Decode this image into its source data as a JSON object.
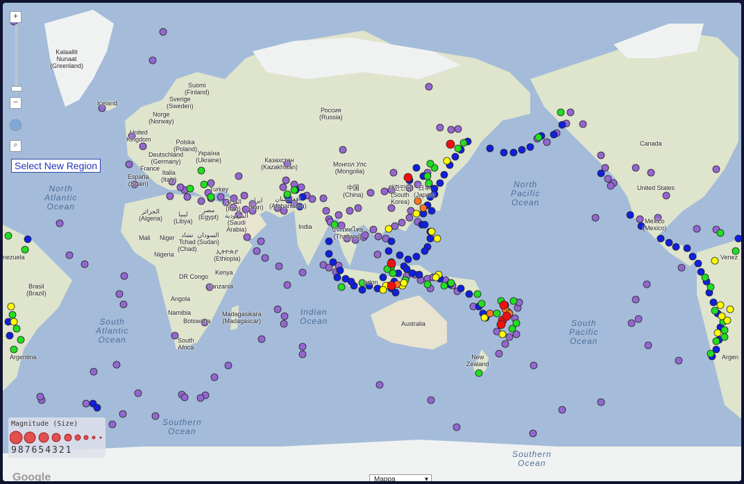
{
  "controls": {
    "zoom_in": "+",
    "zoom_out": "−",
    "select_region": "Select New Region",
    "map_type": "Mappa",
    "google": "Google"
  },
  "legend": {
    "title": "Magnitude (Size)",
    "numbers": "987654321"
  },
  "colors": {
    "ocean": "#a4bcd9",
    "land": "#dfe4cc",
    "magnitude_classes": {
      "purple": "#9467d0",
      "blue": "#1020dd",
      "green": "#22dd22",
      "yellow": "#ffff00",
      "orange": "#ff7722",
      "red": "#ee1111"
    }
  },
  "ocean_labels": [
    {
      "key": "north_atlantic",
      "text": "North\nAtlantic\nOcean"
    },
    {
      "key": "north_pacific",
      "text": "North\nPacific\nOcean"
    },
    {
      "key": "south_atlantic",
      "text": "South\nAtlantic\nOcean"
    },
    {
      "key": "indian",
      "text": "Indian\nOcean"
    },
    {
      "key": "south_pacific",
      "text": "South\nPacific\nOcean"
    },
    {
      "key": "southern1",
      "text": "Southern\nOcean"
    },
    {
      "key": "southern2",
      "text": "Southern\nOcean"
    }
  ],
  "place_labels": [
    {
      "key": "greenland",
      "text": "Kalaallit\nNunaat\n(Greenland)"
    },
    {
      "key": "iceland",
      "text": "Iceland"
    },
    {
      "key": "suomi",
      "text": "Suomi\n(Finland)"
    },
    {
      "key": "sverige",
      "text": "Sverige\n(Sweden)"
    },
    {
      "key": "norge",
      "text": "Norge\n(Norway)"
    },
    {
      "key": "uk",
      "text": "United\nKingdom"
    },
    {
      "key": "poland",
      "text": "Polska\n(Poland)"
    },
    {
      "key": "germany",
      "text": "Deutschland\n(Germany)"
    },
    {
      "key": "ukraine",
      "text": "Україна\n(Ukraine)"
    },
    {
      "key": "france",
      "text": "France"
    },
    {
      "key": "italy",
      "text": "Italia\n(Italy)"
    },
    {
      "key": "spain",
      "text": "España\n(Spain)"
    },
    {
      "key": "turkey",
      "text": "Turkey"
    },
    {
      "key": "russia",
      "text": "Россия\n(Russia)"
    },
    {
      "key": "kazakhstan",
      "text": "Казахстан\n(Kazakhstan)"
    },
    {
      "key": "mongolia",
      "text": "Монгол Улс\n(Mongolia)"
    },
    {
      "key": "china",
      "text": "中国\n(China)"
    },
    {
      "key": "skorea",
      "text": "대한민국\n(South\nKorea)"
    },
    {
      "key": "japan",
      "text": "日本\n(Japan)"
    },
    {
      "key": "algeria",
      "text": "الجزائر\n(Algeria)"
    },
    {
      "key": "libya",
      "text": "ليبيا\n(Libya)"
    },
    {
      "key": "egypt",
      "text": "مصر\n(Egypt)"
    },
    {
      "key": "iraq",
      "text": "العراق\n(Iraq)"
    },
    {
      "key": "iran",
      "text": "ایران\n(Iran)"
    },
    {
      "key": "afghanistan",
      "text": "افغانستان\n(Afghanistan)"
    },
    {
      "key": "saudi",
      "text": "السعودية\n(Saudi\nArabia)"
    },
    {
      "key": "india",
      "text": "India"
    },
    {
      "key": "thailand",
      "text": "ประเทศไทย\n(Thailand)"
    },
    {
      "key": "mali",
      "text": "Mali"
    },
    {
      "key": "niger",
      "text": "Niger"
    },
    {
      "key": "chad",
      "text": "تشاد\nTchad\n(Chad)"
    },
    {
      "key": "sudan",
      "text": "السودان\n(Sudan)"
    },
    {
      "key": "nigeria",
      "text": "Nigeria"
    },
    {
      "key": "ethiopia",
      "text": "ኢትዮጵያ\n(Ethiopia)"
    },
    {
      "key": "kenya",
      "text": "Kenya"
    },
    {
      "key": "drcongo",
      "text": "DR Congo"
    },
    {
      "key": "tanzania",
      "text": "Tanzania"
    },
    {
      "key": "angola",
      "text": "Angola"
    },
    {
      "key": "namibia",
      "text": "Namibia"
    },
    {
      "key": "botswana",
      "text": "Botswana"
    },
    {
      "key": "madagascar",
      "text": "Madagasikara\n(Madagascar)"
    },
    {
      "key": "southafrica",
      "text": "South\nAfrica"
    },
    {
      "key": "indonesia",
      "text": "Indon"
    },
    {
      "key": "australia",
      "text": "Australia"
    },
    {
      "key": "newzealand",
      "text": "New\nZealand"
    },
    {
      "key": "canada",
      "text": "Canada"
    },
    {
      "key": "usa",
      "text": "United States"
    },
    {
      "key": "mexico",
      "text": "México\n(Mexico)"
    },
    {
      "key": "venezuela",
      "text": "nezuela"
    },
    {
      "key": "brasil",
      "text": "Brasil\n(Brazil)"
    },
    {
      "key": "argentina",
      "text": "Argentina"
    },
    {
      "key": "argentina2",
      "text": "Argen"
    },
    {
      "key": "venezuela2",
      "text": "Venez"
    }
  ],
  "quake_markers_by_color": {
    "purple": [
      [
        231,
        42
      ],
      [
        216,
        83
      ],
      [
        16,
        27
      ],
      [
        143,
        152
      ],
      [
        186,
        192
      ],
      [
        202,
        207
      ],
      [
        182,
        233
      ],
      [
        190,
        262
      ],
      [
        241,
        279
      ],
      [
        82,
        318
      ],
      [
        96,
        364
      ],
      [
        118,
        377
      ],
      [
        175,
        394
      ],
      [
        168,
        420
      ],
      [
        174,
        435
      ],
      [
        131,
        532
      ],
      [
        164,
        522
      ],
      [
        195,
        563
      ],
      [
        258,
        565
      ],
      [
        305,
        540
      ],
      [
        325,
        523
      ],
      [
        220,
        596
      ],
      [
        158,
        608
      ],
      [
        173,
        593
      ],
      [
        120,
        578
      ],
      [
        56,
        573
      ],
      [
        54,
        568
      ],
      [
        292,
        566
      ],
      [
        285,
        570
      ],
      [
        262,
        569
      ],
      [
        398,
        380
      ],
      [
        410,
        407
      ],
      [
        378,
        368
      ],
      [
        352,
        338
      ],
      [
        372,
        344
      ],
      [
        396,
        442
      ],
      [
        405,
        463
      ],
      [
        406,
        452
      ],
      [
        373,
        485
      ],
      [
        432,
        496
      ],
      [
        432,
        507
      ],
      [
        366,
        358
      ],
      [
        490,
        212
      ],
      [
        630,
        180
      ],
      [
        646,
        183
      ],
      [
        656,
        182
      ],
      [
        614,
        121
      ],
      [
        541,
        337
      ],
      [
        575,
        317
      ],
      [
        565,
        322
      ],
      [
        534,
        327
      ],
      [
        520,
        338
      ],
      [
        540,
        363
      ],
      [
        552,
        340
      ],
      [
        432,
        389
      ],
      [
        298,
        410
      ],
      [
        291,
        461
      ],
      [
        248,
        480
      ],
      [
        340,
        250
      ],
      [
        360,
        290
      ],
      [
        405,
        300
      ],
      [
        420,
        290
      ],
      [
        462,
        282
      ],
      [
        466,
        300
      ],
      [
        470,
        312
      ],
      [
        484,
        306
      ],
      [
        500,
        300
      ],
      [
        512,
        296
      ],
      [
        530,
        274
      ],
      [
        560,
        270
      ],
      [
        563,
        245
      ],
      [
        586,
        267
      ],
      [
        598,
        262
      ],
      [
        612,
        245
      ],
      [
        588,
        300
      ],
      [
        586,
        310
      ],
      [
        598,
        316
      ],
      [
        770,
        196
      ],
      [
        784,
        201
      ],
      [
        798,
        188
      ],
      [
        812,
        174
      ],
      [
        818,
        158
      ],
      [
        836,
        175
      ],
      [
        862,
        220
      ],
      [
        868,
        238
      ],
      [
        872,
        254
      ],
      [
        880,
        260
      ],
      [
        876,
        264
      ],
      [
        912,
        238
      ],
      [
        934,
        245
      ],
      [
        956,
        278
      ],
      [
        1028,
        240
      ],
      [
        1000,
        326
      ],
      [
        1028,
        327
      ],
      [
        854,
        310
      ],
      [
        918,
        312
      ],
      [
        944,
        310
      ],
      [
        978,
        382
      ],
      [
        912,
        428
      ],
      [
        928,
        406
      ],
      [
        906,
        462
      ],
      [
        916,
        456
      ],
      [
        930,
        494
      ],
      [
        974,
        516
      ],
      [
        765,
        523
      ],
      [
        654,
        612
      ],
      [
        764,
        621
      ],
      [
        806,
        587
      ],
      [
        862,
        576
      ],
      [
        617,
        573
      ],
      [
        543,
        551
      ],
      [
        715,
        506
      ],
      [
        724,
        492
      ],
      [
        730,
        482
      ],
      [
        740,
        478
      ],
      [
        712,
        474
      ],
      [
        742,
        440
      ],
      [
        724,
        436
      ],
      [
        744,
        432
      ],
      [
        738,
        455
      ],
      [
        655,
        416
      ],
      [
        648,
        408
      ],
      [
        638,
        400
      ],
      [
        602,
        400
      ],
      [
        582,
        394
      ],
      [
        594,
        392
      ],
      [
        612,
        398
      ],
      [
        620,
        396
      ],
      [
        560,
        296
      ],
      [
        550,
        272
      ],
      [
        508,
        342
      ],
      [
        496,
        340
      ],
      [
        488,
        321
      ],
      [
        472,
        316
      ],
      [
        462,
        378
      ],
      [
        470,
        382
      ],
      [
        480,
        388
      ],
      [
        484,
        379
      ],
      [
        332,
        295
      ],
      [
        322,
        288
      ],
      [
        314,
        280
      ],
      [
        300,
        282
      ],
      [
        286,
        286
      ],
      [
        266,
        280
      ],
      [
        262,
        270
      ],
      [
        256,
        266
      ],
      [
        244,
        258
      ],
      [
        300,
        260
      ],
      [
        296,
        274
      ],
      [
        333,
        282
      ],
      [
        348,
        278
      ],
      [
        404,
        266
      ],
      [
        410,
        278
      ],
      [
        420,
        262
      ],
      [
        430,
        266
      ],
      [
        408,
        256
      ],
      [
        438,
        278
      ],
      [
        446,
        283
      ],
      [
        522,
        335
      ],
      [
        410,
        232
      ],
      [
        396,
        296
      ],
      [
        360,
        300
      ],
      [
        350,
        298
      ],
      [
        340,
        306
      ],
      [
        556,
        408
      ],
      [
        616,
        412
      ],
      [
        678,
        438
      ]
    ],
    "blue": [
      [
        36,
        341
      ],
      [
        670,
        200
      ],
      [
        660,
        212
      ],
      [
        652,
        222
      ],
      [
        644,
        234
      ],
      [
        636,
        248
      ],
      [
        630,
        260
      ],
      [
        622,
        268
      ],
      [
        616,
        280
      ],
      [
        612,
        292
      ],
      [
        606,
        304
      ],
      [
        604,
        320
      ],
      [
        612,
        352
      ],
      [
        608,
        358
      ],
      [
        596,
        366
      ],
      [
        584,
        370
      ],
      [
        578,
        380
      ],
      [
        570,
        390
      ],
      [
        564,
        402
      ],
      [
        560,
        412
      ],
      [
        540,
        412
      ],
      [
        528,
        408
      ],
      [
        518,
        414
      ],
      [
        506,
        408
      ],
      [
        494,
        398
      ],
      [
        486,
        386
      ],
      [
        476,
        374
      ],
      [
        470,
        362
      ],
      [
        470,
        344
      ],
      [
        560,
        344
      ],
      [
        556,
        358
      ],
      [
        560,
        374
      ],
      [
        572,
        364
      ],
      [
        582,
        384
      ],
      [
        590,
        390
      ],
      [
        600,
        392
      ],
      [
        630,
        398
      ],
      [
        644,
        406
      ],
      [
        660,
        412
      ],
      [
        672,
        420
      ],
      [
        686,
        438
      ],
      [
        692,
        448
      ],
      [
        696,
        454
      ],
      [
        702,
        210
      ],
      [
        722,
        216
      ],
      [
        736,
        216
      ],
      [
        748,
        212
      ],
      [
        760,
        208
      ],
      [
        776,
        192
      ],
      [
        794,
        190
      ],
      [
        806,
        176
      ],
      [
        862,
        246
      ],
      [
        904,
        306
      ],
      [
        920,
        322
      ],
      [
        948,
        340
      ],
      [
        960,
        346
      ],
      [
        970,
        352
      ],
      [
        986,
        354
      ],
      [
        994,
        366
      ],
      [
        1002,
        376
      ],
      [
        1006,
        388
      ],
      [
        1014,
        402
      ],
      [
        1018,
        418
      ],
      [
        1024,
        432
      ],
      [
        1030,
        448
      ],
      [
        1034,
        468
      ],
      [
        1032,
        486
      ],
      [
        1028,
        500
      ],
      [
        1022,
        510
      ],
      [
        8,
        460
      ],
      [
        10,
        480
      ],
      [
        130,
        578
      ],
      [
        136,
        584
      ],
      [
        422,
        270
      ],
      [
        428,
        294
      ],
      [
        412,
        284
      ],
      [
        432,
        280
      ],
      [
        596,
        238
      ],
      [
        606,
        250
      ],
      [
        586,
        256
      ],
      [
        614,
        262
      ],
      [
        622,
        276
      ],
      [
        618,
        300
      ],
      [
        608,
        320
      ],
      [
        616,
        330
      ],
      [
        616,
        340
      ],
      [
        482,
        396
      ],
      [
        502,
        402
      ],
      [
        548,
        396
      ],
      [
        566,
        418
      ],
      [
        1060,
        340
      ]
    ],
    "green": [
      [
        612,
        250
      ],
      [
        656,
        210
      ],
      [
        664,
        202
      ],
      [
        804,
        158
      ],
      [
        772,
        194
      ],
      [
        286,
        242
      ],
      [
        300,
        280
      ],
      [
        290,
        262
      ],
      [
        270,
        268
      ],
      [
        410,
        276
      ],
      [
        420,
        270
      ],
      [
        32,
        356
      ],
      [
        8,
        336
      ],
      [
        14,
        450
      ],
      [
        20,
        470
      ],
      [
        26,
        486
      ],
      [
        1012,
        396
      ],
      [
        1020,
        410
      ],
      [
        1026,
        444
      ],
      [
        1038,
        460
      ],
      [
        1040,
        472
      ],
      [
        1040,
        482
      ],
      [
        1028,
        488
      ],
      [
        1020,
        506
      ],
      [
        1056,
        358
      ],
      [
        1034,
        332
      ],
      [
        736,
        430
      ],
      [
        728,
        446
      ],
      [
        740,
        462
      ],
      [
        734,
        470
      ],
      [
        718,
        430
      ],
      [
        614,
        260
      ],
      [
        622,
        238
      ],
      [
        616,
        232
      ],
      [
        562,
        390
      ],
      [
        580,
        400
      ],
      [
        612,
        406
      ],
      [
        636,
        408
      ],
      [
        646,
        404
      ],
      [
        684,
        420
      ],
      [
        690,
        434
      ],
      [
        560,
        380
      ],
      [
        554,
        384
      ],
      [
        478,
        320
      ],
      [
        488,
        410
      ],
      [
        686,
        534
      ],
      [
        712,
        448
      ],
      [
        16,
        500
      ],
      [
        518,
        404
      ]
    ],
    "yellow": [
      [
        12,
        438
      ],
      [
        16,
        460
      ],
      [
        1026,
        372
      ],
      [
        1034,
        436
      ],
      [
        1048,
        442
      ],
      [
        1044,
        458
      ],
      [
        1030,
        476
      ],
      [
        1036,
        452
      ],
      [
        556,
        326
      ],
      [
        576,
        408
      ],
      [
        552,
        408
      ],
      [
        618,
        330
      ],
      [
        626,
        340
      ],
      [
        694,
        454
      ],
      [
        720,
        478
      ],
      [
        548,
        414
      ],
      [
        628,
        392
      ],
      [
        640,
        228
      ],
      [
        596,
        304
      ],
      [
        578,
        404
      ],
      [
        624,
        396
      ]
    ],
    "orange": [
      [
        598,
        286
      ],
      [
        606,
        296
      ],
      [
        724,
        442
      ],
      [
        730,
        448
      ],
      [
        568,
        406
      ],
      [
        702,
        448
      ]
    ],
    "red": [
      [
        584,
        252
      ],
      [
        645,
        204
      ],
      [
        560,
        376
      ],
      [
        560,
        408
      ],
      [
        722,
        436
      ],
      [
        720,
        458
      ],
      [
        718,
        464
      ],
      [
        726,
        452
      ]
    ]
  }
}
